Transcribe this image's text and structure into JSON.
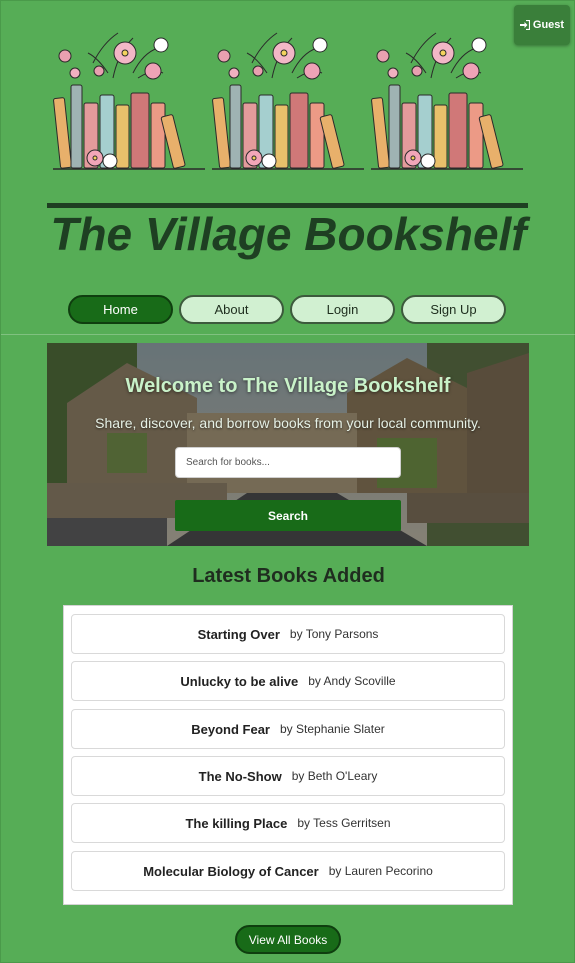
{
  "header": {
    "guest_label": "Guest",
    "site_title": "The Village Bookshelf"
  },
  "nav": {
    "items": [
      {
        "label": "Home",
        "active": true
      },
      {
        "label": "About",
        "active": false
      },
      {
        "label": "Login",
        "active": false
      },
      {
        "label": "Sign Up",
        "active": false
      }
    ]
  },
  "hero": {
    "heading": "Welcome to The Village Bookshelf",
    "subtitle": "Share, discover, and borrow books from your local community.",
    "search_placeholder": "Search for books...",
    "search_button": "Search"
  },
  "latest": {
    "heading": "Latest Books Added",
    "books": [
      {
        "title": "Starting Over",
        "author": "by Tony Parsons"
      },
      {
        "title": "Unlucky to be alive",
        "author": "by Andy Scoville"
      },
      {
        "title": "Beyond Fear",
        "author": "by Stephanie Slater"
      },
      {
        "title": "The No-Show",
        "author": "by Beth O'Leary"
      },
      {
        "title": "The killing Place",
        "author": "by Tess Gerritsen"
      },
      {
        "title": "Molecular Biology of Cancer",
        "author": "by Lauren Pecorino"
      }
    ],
    "view_all_label": "View All Books"
  },
  "colors": {
    "page_background": "#56ad56",
    "primary_green": "#186b18",
    "nav_inactive": "#d1f0d1",
    "title_color": "#1e3f22",
    "hero_heading": "#c9f2c9"
  },
  "icons": {
    "guest": "sign-in-icon",
    "banner": "books-and-flowers-illustration"
  }
}
